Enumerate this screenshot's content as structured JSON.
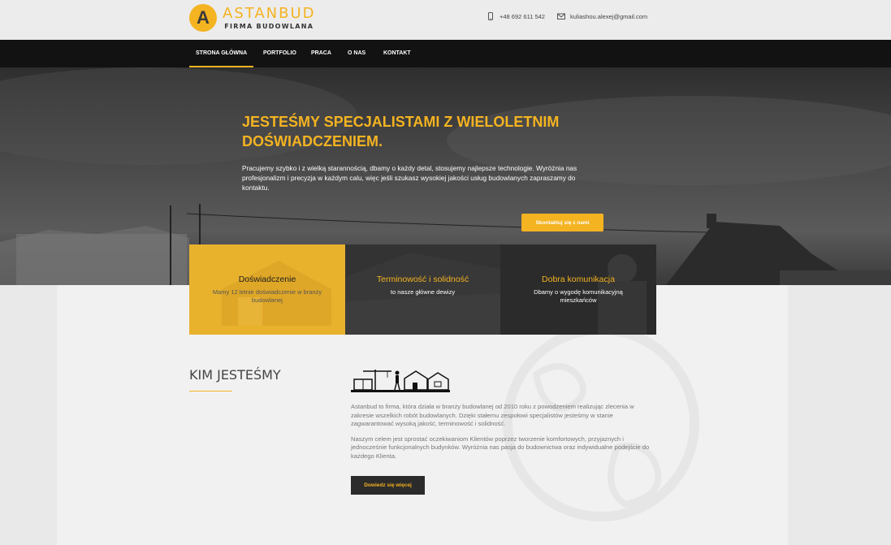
{
  "brand": {
    "initial": "A",
    "name": "ASTANBUD",
    "tagline": "FIRMA BUDOWLANA"
  },
  "contact": {
    "phone": "+48 692 611 542",
    "email": "kuliashou.alexej@gmail.com"
  },
  "nav": [
    "STRONA GŁÓWNA",
    "PORTFOLIO",
    "PRACA",
    "O NAS",
    "KONTAKT"
  ],
  "hero": {
    "title": "JESTEŚMY SPECJALISTAMI Z WIELOLETNIM DOŚWIADCZENIEM.",
    "text": "Pracujemy szybko i z wielką starannością, dbamy o każdy detal, stosujemy najlepsze technologie. Wyróżnia nas profesjonalizm i precyzja w każdym calu, więc jeśli szukasz wysokiej jakości usług budowlanych zapraszamy do kontaktu.",
    "button": "Skontaktuj się z nami"
  },
  "features": [
    {
      "title": "Doświadczenie",
      "desc": "Mamy 12 letnie doświadczenie w branży budowlanej"
    },
    {
      "title": "Terminowość i solidność",
      "desc": "to nasze główne dewizy"
    },
    {
      "title": "Dobra komunikacja",
      "desc": "Dbamy o wygodę komunikacyjną mieszkańców"
    }
  ],
  "about": {
    "title": "KIM JESTEŚMY",
    "p1": "Astanbud to firma, która działa w branży budowlanej od 2010 roku z powodzeniem realizując zlecenia w zakresie wszelkich robót budowlanych. Dzięki stałemu zespołowi specjalistów jesteśmy w stanie zagwarantować wysoką jakość, terminowość i solidność.",
    "p2": "Naszym celem jest sprostać oczekiwaniom Klientów poprzez tworzenie komfortowych, przyjaznych i jednocześnie funkcjonalnych budynków. Wyróżnia nas pasja do budownictwa oraz indywidualne podejście do każdego Klienta.",
    "button": "Dowiedz się więcej"
  },
  "colors": {
    "accent": "#f4b321",
    "dark": "#121212"
  }
}
